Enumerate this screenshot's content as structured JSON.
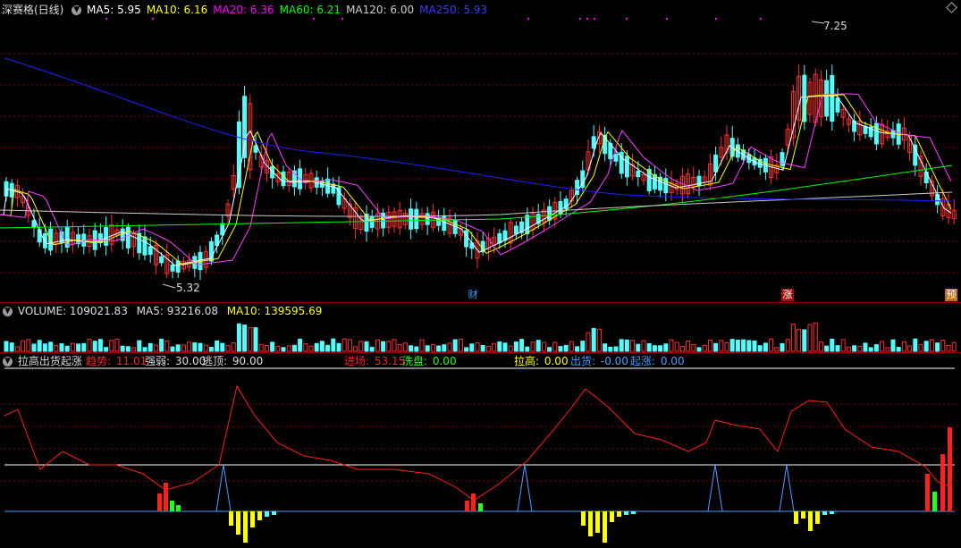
{
  "header": {
    "title": "深赛格(日线)",
    "ma": [
      {
        "label": "MA5: 5.95",
        "color": "#ffffff"
      },
      {
        "label": "MA10: 6.16",
        "color": "#ffff00"
      },
      {
        "label": "MA20: 6.36",
        "color": "#ff00ff"
      },
      {
        "label": "MA60: 6.21",
        "color": "#00ff00"
      },
      {
        "label": "MA120: 6.00",
        "color": "#cccccc"
      },
      {
        "label": "MA250: 5.93",
        "color": "#3a3aff"
      }
    ],
    "high_label": "7.25",
    "low_label": "5.32",
    "tag_cai": "财",
    "tag_zhang": "涨",
    "tag_yu": "预"
  },
  "volume": {
    "title": "VOLUME: 109021.83",
    "ma5": "MA5: 93216.08",
    "ma10": "MA10: 139595.69"
  },
  "indicator": {
    "title": "拉高出货起涨",
    "items": [
      {
        "name": "趋势",
        "value": "11.01",
        "color": "#ff2020"
      },
      {
        "name": "强弱",
        "value": "30.00",
        "color": "#dddddd"
      },
      {
        "name": "逃顶",
        "value": "90.00",
        "color": "#dddddd"
      },
      {
        "name": "进场",
        "value": "53.15",
        "color": "#ff2020"
      },
      {
        "name": "洗盘",
        "value": "0.00",
        "color": "#20ff20"
      },
      {
        "name": "拉高",
        "value": "0.00",
        "color": "#ffff00"
      },
      {
        "name": "出货",
        "value": "-0.00",
        "color": "#40a0ff"
      },
      {
        "name": "起涨",
        "value": "0.00",
        "color": "#40a0ff"
      }
    ]
  },
  "colors": {
    "up": "#ff3030",
    "down": "#54fcfc",
    "ma250": "#2020ff"
  }
}
